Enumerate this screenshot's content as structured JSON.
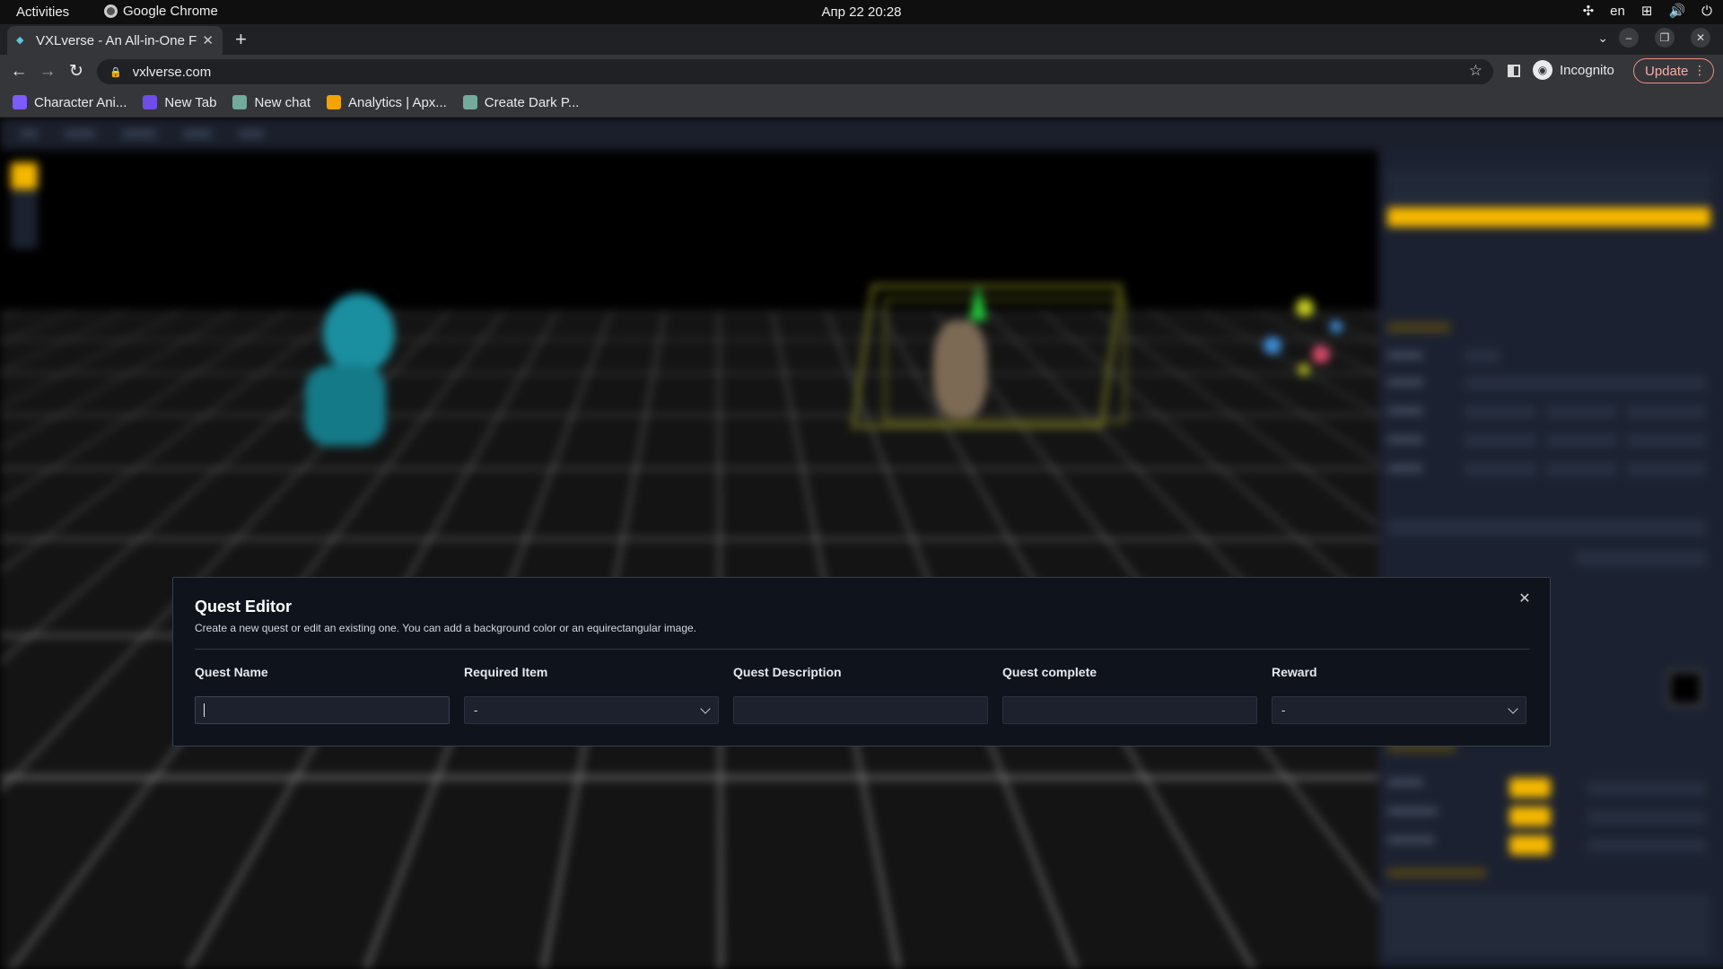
{
  "system_bar": {
    "activities": "Activities",
    "app_name": "Google Chrome",
    "clock": "Апр 22  20:28",
    "language": "en"
  },
  "browser": {
    "tab_title": "VXLverse - An All-in-One F",
    "url": "vxlverse.com",
    "profile_label": "Incognito",
    "update_label": "Update",
    "bookmarks": [
      {
        "label": "Character Ani...",
        "icon_color": "#7b5cff"
      },
      {
        "label": "New Tab",
        "icon_color": "#6e4de8"
      },
      {
        "label": "New chat",
        "icon_color": "#74aa9c"
      },
      {
        "label": "Analytics | Apx...",
        "icon_color": "#f4a300"
      },
      {
        "label": "Create Dark P...",
        "icon_color": "#74aa9c"
      }
    ]
  },
  "modal": {
    "title": "Quest Editor",
    "subtitle": "Create a new quest or edit an existing one. You can add a background color or an equirectangular image.",
    "fields": {
      "quest_name": {
        "label": "Quest Name",
        "value": ""
      },
      "required_item": {
        "label": "Required Item",
        "selected": "-"
      },
      "quest_description": {
        "label": "Quest Description",
        "value": ""
      },
      "quest_complete": {
        "label": "Quest complete",
        "value": ""
      },
      "reward": {
        "label": "Reward",
        "selected": "-"
      }
    }
  },
  "colors": {
    "accent": "#f5b800",
    "modal_bg": "#0f131c",
    "panel_bg": "#1b2130"
  }
}
